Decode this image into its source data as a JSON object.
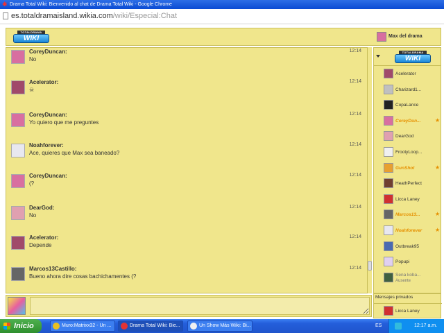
{
  "window": {
    "title": "Drama Total Wiki: Bienvenido al chat de Drama Total Wiki - Google Chrome"
  },
  "address": {
    "host": "es.totaldramaisland.wikia.com",
    "path": "/wiki/Especial:Chat"
  },
  "header": {
    "logo_top": "TOTALDRAMA",
    "logo_text": "WIKI",
    "current_user": "Max del drama"
  },
  "messages": [
    {
      "author": "CoreyDuncan:",
      "text": "No",
      "time": "12:14",
      "avatar_color": "#d86fa0"
    },
    {
      "author": "Acelerator:",
      "text": "☠",
      "time": "12:14",
      "avatar_color": "#a04a6a"
    },
    {
      "author": "CoreyDuncan:",
      "text": "Yo quiero que me preguntes",
      "time": "12:14",
      "avatar_color": "#d86fa0"
    },
    {
      "author": "Noahforever:",
      "text": "Ace, quieres que Max sea baneado?",
      "time": "12:14",
      "avatar_color": "#e8e8f0"
    },
    {
      "author": "CoreyDuncan:",
      "text": "(?",
      "time": "12:14",
      "avatar_color": "#d86fa0"
    },
    {
      "author": "DearGod:",
      "text": "No",
      "time": "12:14",
      "avatar_color": "#e0a0b0"
    },
    {
      "author": "Acelerator:",
      "text": "Depende",
      "time": "12:14",
      "avatar_color": "#a04a6a"
    },
    {
      "author": "Marcos13Castillo:",
      "text": "Bueno ahora dire cosas bachichamentes (?",
      "time": "12:14",
      "avatar_color": "#666666"
    }
  ],
  "sidebar": {
    "users": [
      {
        "name": "Acelerator",
        "mod": false,
        "avatar_color": "#a04a6a"
      },
      {
        "name": "Charizard1...",
        "mod": false,
        "avatar_color": "#c0c0c0"
      },
      {
        "name": "CopaLance",
        "mod": false,
        "avatar_color": "#222222"
      },
      {
        "name": "CoreyDun...",
        "mod": true,
        "avatar_color": "#d86fa0"
      },
      {
        "name": "DearGod",
        "mod": false,
        "avatar_color": "#e0a0b0"
      },
      {
        "name": "FrootyLoop...",
        "mod": false,
        "avatar_color": "#f0f0f0"
      },
      {
        "name": "GunShot",
        "mod": true,
        "avatar_color": "#e8a030"
      },
      {
        "name": "HeathPerfect",
        "mod": false,
        "avatar_color": "#704030"
      },
      {
        "name": "Licca Laney",
        "mod": false,
        "avatar_color": "#d03030"
      },
      {
        "name": "Marcos13...",
        "mod": true,
        "avatar_color": "#666666"
      },
      {
        "name": "Noahforever",
        "mod": true,
        "avatar_color": "#e8e8f0"
      },
      {
        "name": "Outbreak95",
        "mod": false,
        "avatar_color": "#4a6ab0"
      },
      {
        "name": "Popupi",
        "mod": false,
        "avatar_color": "#e0d0f0"
      },
      {
        "name": "Sena koba...",
        "mod": false,
        "status": "Ausente",
        "avatar_color": "#406040"
      }
    ],
    "pm_title": "Mensajes privados",
    "pm_user": {
      "name": "Licca Laney",
      "avatar_color": "#d03030"
    }
  },
  "input": {
    "value": ""
  },
  "taskbar": {
    "start": "Inicio",
    "tasks": [
      {
        "label": "Muro:Matrixx32 - Un ...",
        "color": "#e8c020"
      },
      {
        "label": "Drama Total Wiki: Bie...",
        "color": "#e33333"
      },
      {
        "label": "Un Show Más Wiki: Bi...",
        "color": "#f0f0f0"
      }
    ],
    "lang": "ES",
    "clock": "12:17 a.m."
  }
}
